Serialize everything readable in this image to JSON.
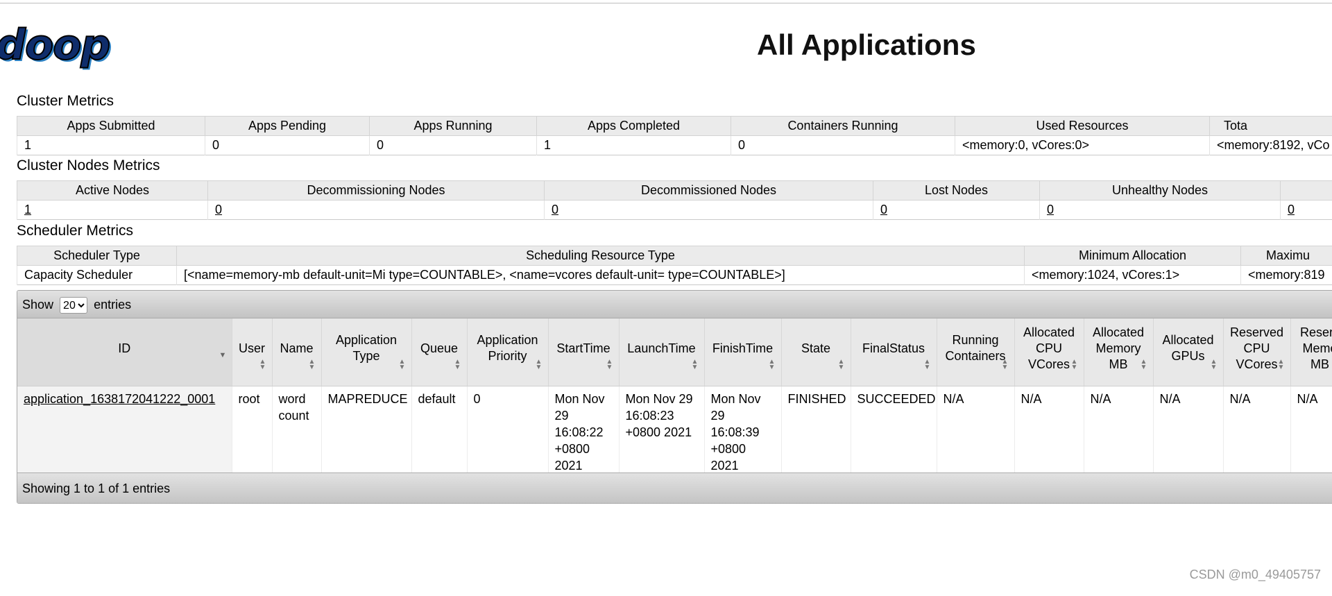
{
  "header": {
    "logo_text": "doop",
    "title": "All Applications"
  },
  "cluster_metrics": {
    "title": "Cluster Metrics",
    "headers": [
      "Apps Submitted",
      "Apps Pending",
      "Apps Running",
      "Apps Completed",
      "Containers Running",
      "Used Resources",
      "Tota"
    ],
    "values": [
      "1",
      "0",
      "0",
      "1",
      "0",
      "<memory:0, vCores:0>",
      "<memory:8192, vCo"
    ]
  },
  "cluster_nodes_metrics": {
    "title": "Cluster Nodes Metrics",
    "headers": [
      "Active Nodes",
      "Decommissioning Nodes",
      "Decommissioned Nodes",
      "Lost Nodes",
      "Unhealthy Nodes",
      ""
    ],
    "values": [
      "1",
      "0",
      "0",
      "0",
      "0",
      "0"
    ]
  },
  "scheduler_metrics": {
    "title": "Scheduler Metrics",
    "headers": [
      "Scheduler Type",
      "Scheduling Resource Type",
      "Minimum Allocation",
      "Maximu"
    ],
    "values": [
      "Capacity Scheduler",
      "[<name=memory-mb default-unit=Mi type=COUNTABLE>, <name=vcores default-unit= type=COUNTABLE>]",
      "<memory:1024, vCores:1>",
      "<memory:819"
    ]
  },
  "applications": {
    "show_label": "Show",
    "entries_label": "entries",
    "page_size": "20",
    "page_size_options": [
      "20"
    ],
    "columns": [
      "ID",
      "User",
      "Name",
      "Application Type",
      "Queue",
      "Application Priority",
      "StartTime",
      "LaunchTime",
      "FinishTime",
      "State",
      "FinalStatus",
      "Running Containers",
      "Allocated CPU VCores",
      "Allocated Memory MB",
      "Allocated GPUs",
      "Reserved CPU VCores",
      "Reserv Memo MB"
    ],
    "rows": [
      {
        "id": "application_1638172041222_0001",
        "user": "root",
        "name": "word count",
        "app_type": "MAPREDUCE",
        "queue": "default",
        "priority": "0",
        "start_time": "Mon Nov 29 16:08:22 +0800 2021",
        "launch_time": "Mon Nov 29 16:08:23 +0800 2021",
        "finish_time": "Mon Nov 29 16:08:39 +0800 2021",
        "state": "FINISHED",
        "final_status": "SUCCEEDED",
        "running_containers": "N/A",
        "alloc_cpu": "N/A",
        "alloc_mem": "N/A",
        "alloc_gpus": "N/A",
        "reserved_cpu": "N/A",
        "reserved_mem": "N/A"
      }
    ],
    "info": "Showing 1 to 1 of 1 entries"
  },
  "watermark": "CSDN @m0_49405757"
}
